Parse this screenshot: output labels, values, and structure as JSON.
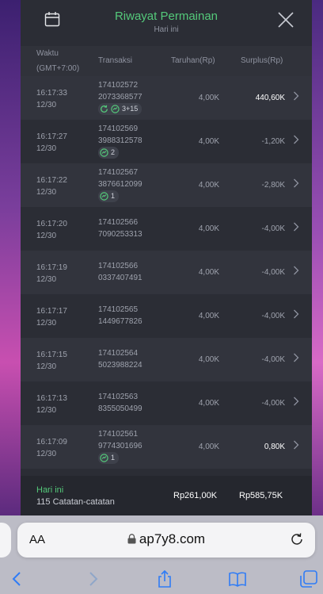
{
  "header": {
    "title": "Riwayat Permainan",
    "subtitle": "Hari ini"
  },
  "columns": {
    "time": "Waktu",
    "time_tz": "(GMT+7:00)",
    "tx": "Transaksi",
    "bet": "Taruhan(Rp)",
    "surplus": "Surplus(Rp)"
  },
  "rows": [
    {
      "time": "16:17:33",
      "date": "12/30",
      "tx1": "174102572",
      "tx2": "2073368577",
      "badge": "3+15",
      "badge_type": "spin+free",
      "bet": "4,00K",
      "surplus": "440,60K",
      "win": true
    },
    {
      "time": "16:17:27",
      "date": "12/30",
      "tx1": "174102569",
      "tx2": "3988312578",
      "badge": "2",
      "badge_type": "free",
      "bet": "4,00K",
      "surplus": "-1,20K",
      "win": false
    },
    {
      "time": "16:17:22",
      "date": "12/30",
      "tx1": "174102567",
      "tx2": "3876612099",
      "badge": "1",
      "badge_type": "free",
      "bet": "4,00K",
      "surplus": "-2,80K",
      "win": false
    },
    {
      "time": "16:17:20",
      "date": "12/30",
      "tx1": "174102566",
      "tx2": "7090253313",
      "badge": "",
      "bet": "4,00K",
      "surplus": "-4,00K",
      "win": false
    },
    {
      "time": "16:17:19",
      "date": "12/30",
      "tx1": "174102566",
      "tx2": "0337407491",
      "badge": "",
      "bet": "4,00K",
      "surplus": "-4,00K",
      "win": false
    },
    {
      "time": "16:17:17",
      "date": "12/30",
      "tx1": "174102565",
      "tx2": "1449677826",
      "badge": "",
      "bet": "4,00K",
      "surplus": "-4,00K",
      "win": false
    },
    {
      "time": "16:17:15",
      "date": "12/30",
      "tx1": "174102564",
      "tx2": "5023988224",
      "badge": "",
      "bet": "4,00K",
      "surplus": "-4,00K",
      "win": false
    },
    {
      "time": "16:17:13",
      "date": "12/30",
      "tx1": "174102563",
      "tx2": "8355050499",
      "badge": "",
      "bet": "4,00K",
      "surplus": "-4,00K",
      "win": false
    },
    {
      "time": "16:17:09",
      "date": "12/30",
      "tx1": "174102561",
      "tx2": "9774301696",
      "badge": "1",
      "badge_type": "free",
      "bet": "4,00K",
      "surplus": "0,80K",
      "win": true
    }
  ],
  "footer": {
    "label": "Hari ini",
    "count": "115 Catatan-catatan",
    "total_bet": "Rp261,00K",
    "total_surplus": "Rp585,75K"
  },
  "browser": {
    "aa": "AA",
    "url": "ap7y8.com"
  },
  "colors": {
    "accent": "#54c97a",
    "panel": "#2b2d35"
  }
}
